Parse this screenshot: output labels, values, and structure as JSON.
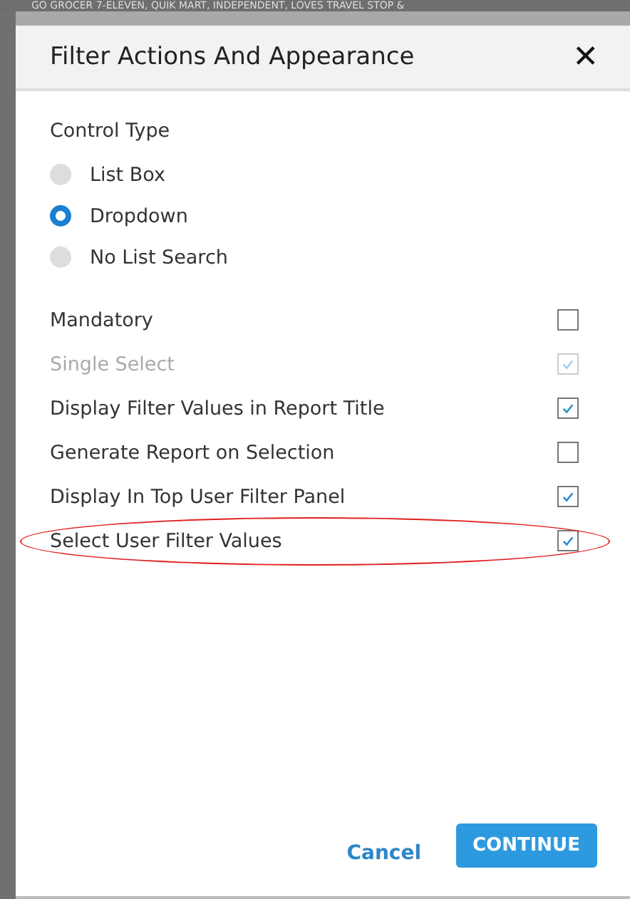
{
  "background_text": "GO GROCER 7-ELEVEN, QUIK MART, INDEPENDENT, LOVES TRAVEL STOP &",
  "dialog": {
    "title": "Filter Actions And Appearance",
    "close": "✕"
  },
  "control_type": {
    "label": "Control Type",
    "options": [
      {
        "label": "List Box",
        "selected": false
      },
      {
        "label": "Dropdown",
        "selected": true
      },
      {
        "label": "No List Search",
        "selected": false
      }
    ]
  },
  "options": [
    {
      "label": "Mandatory",
      "checked": false,
      "disabled": false,
      "highlighted": false
    },
    {
      "label": "Single Select",
      "checked": true,
      "disabled": true,
      "highlighted": false
    },
    {
      "label": "Display Filter Values in Report Title",
      "checked": true,
      "disabled": false,
      "highlighted": false
    },
    {
      "label": "Generate Report on Selection",
      "checked": false,
      "disabled": false,
      "highlighted": false
    },
    {
      "label": "Display In Top User Filter Panel",
      "checked": true,
      "disabled": false,
      "highlighted": false
    },
    {
      "label": "Select User Filter Values",
      "checked": true,
      "disabled": false,
      "highlighted": true
    }
  ],
  "buttons": {
    "cancel": "Cancel",
    "continue": "CONTINUE"
  }
}
